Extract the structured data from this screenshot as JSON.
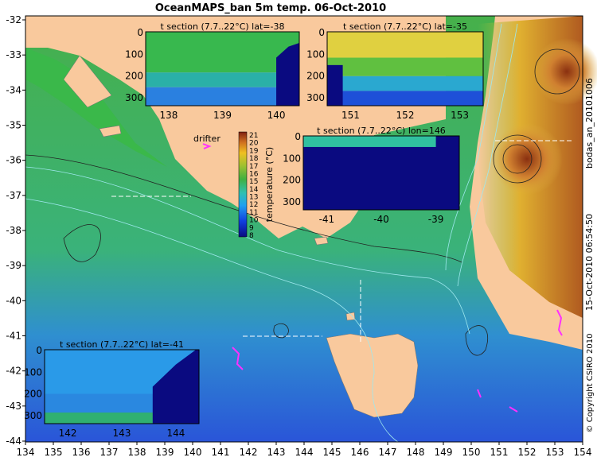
{
  "title": "OceanMAPS_ban 5m temp. 06-Oct-2010",
  "right_stamp_top": "bodas_an_20101006",
  "right_stamp_bottom": "15-Oct-2010 06:54:50",
  "copyright": "© Copyright CSIRO 2010",
  "drifter_label": "drifter",
  "colorbar": {
    "label": "temperature (°C)",
    "ticks": [
      "8",
      "9",
      "10",
      "11",
      "12",
      "13",
      "14",
      "15",
      "16",
      "17",
      "18",
      "19",
      "20",
      "21"
    ]
  },
  "map": {
    "lon_ticks": [
      "134",
      "135",
      "136",
      "137",
      "138",
      "139",
      "140",
      "141",
      "142",
      "143",
      "144",
      "145",
      "146",
      "147",
      "148",
      "149",
      "150",
      "151",
      "152",
      "153",
      "154"
    ],
    "lat_ticks": [
      "-32",
      "-33",
      "-34",
      "-35",
      "-36",
      "-37",
      "-38",
      "-39",
      "-40",
      "-41",
      "-42",
      "-43",
      "-44"
    ]
  },
  "insets": [
    {
      "id": "lat38",
      "title": "t section (7.7..22°C) lat=-38",
      "yticks": [
        "0",
        "100",
        "200",
        "300"
      ],
      "xticks": [
        "138",
        "139",
        "140"
      ]
    },
    {
      "id": "lat35",
      "title": "t section (7.7..22°C) lat=-35",
      "yticks": [
        "0",
        "100",
        "200",
        "300"
      ],
      "xticks": [
        "151",
        "152",
        "153"
      ]
    },
    {
      "id": "lon146",
      "title": "t section (7.7..22°C) lon=146",
      "yticks": [
        "0",
        "100",
        "200",
        "300"
      ],
      "xticks": [
        "-41",
        "-40",
        "-39"
      ]
    },
    {
      "id": "lat41",
      "title": "t section (7.7..22°C) lat=-41",
      "yticks": [
        "0",
        "100",
        "200",
        "300"
      ],
      "xticks": [
        "142",
        "143",
        "144"
      ]
    }
  ],
  "colors": {
    "land": "#f9c99d",
    "ocean_mid": "#3fb24a",
    "warm": "#c87a2a",
    "cold": "#1e60d0",
    "deep": "#0a1a80"
  }
}
